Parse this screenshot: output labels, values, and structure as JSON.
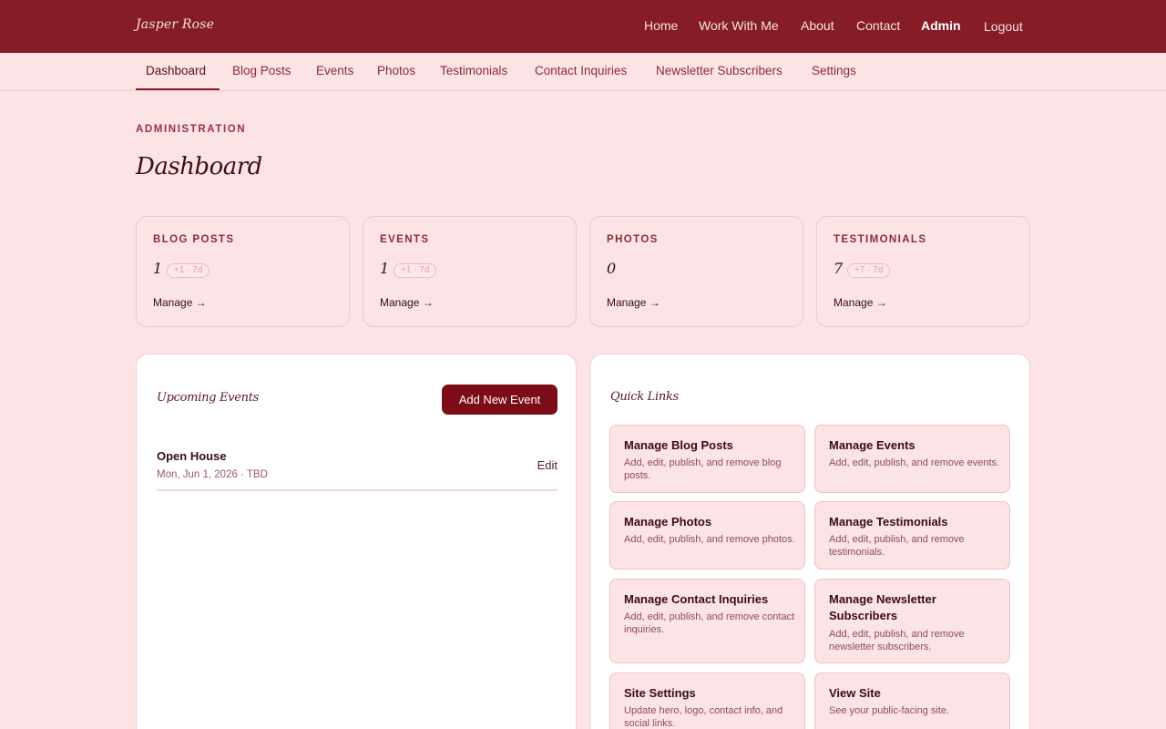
{
  "header": {
    "brand": "Jasper Rose",
    "nav": [
      "Home",
      "Work With Me",
      "About",
      "Contact",
      "Admin",
      "Logout"
    ]
  },
  "tabs": [
    "Dashboard",
    "Blog Posts",
    "Events",
    "Photos",
    "Testimonials",
    "Contact Inquiries",
    "Newsletter Subscribers",
    "Settings"
  ],
  "page": {
    "eyebrow": "ADMINISTRATION",
    "title": "Dashboard"
  },
  "stats": [
    {
      "label": "BLOG POSTS",
      "value": "1",
      "badge": "+1 · 7d",
      "link": "Manage →"
    },
    {
      "label": "EVENTS",
      "value": "1",
      "badge": "+1 · 7d",
      "link": "Manage →"
    },
    {
      "label": "PHOTOS",
      "value": "0",
      "badge": "",
      "link": "Manage →"
    },
    {
      "label": "TESTIMONIALS",
      "value": "7",
      "badge": "+7 · 7d",
      "link": "Manage →"
    }
  ],
  "upcoming": {
    "title": "Upcoming Events",
    "add_button": "Add New Event",
    "events": [
      {
        "title": "Open House",
        "meta": "Mon, Jun 1, 2026 · TBD",
        "action": "Edit"
      }
    ]
  },
  "quick_links": {
    "title": "Quick Links",
    "items": [
      {
        "title": "Manage Blog Posts",
        "desc": "Add, edit, publish, and remove blog posts."
      },
      {
        "title": "Manage Events",
        "desc": "Add, edit, publish, and remove events."
      },
      {
        "title": "Manage Photos",
        "desc": "Add, edit, publish, and remove photos."
      },
      {
        "title": "Manage Testimonials",
        "desc": "Add, edit, publish, and remove testimonials."
      },
      {
        "title": "Manage Contact Inquiries",
        "desc": "Add, edit, publish, and remove contact inquiries."
      },
      {
        "title": "Manage Newsletter Subscribers",
        "desc": "Add, edit, publish, and remove newsletter subscribers."
      },
      {
        "title": "Site Settings",
        "desc": "Update hero, logo, contact info, and social links."
      },
      {
        "title": "View Site",
        "desc": "See your public-facing site."
      }
    ]
  },
  "colors": {
    "header_bg": "#851c26",
    "page_bg": "#fce4e6",
    "accent": "#7c0c17"
  }
}
